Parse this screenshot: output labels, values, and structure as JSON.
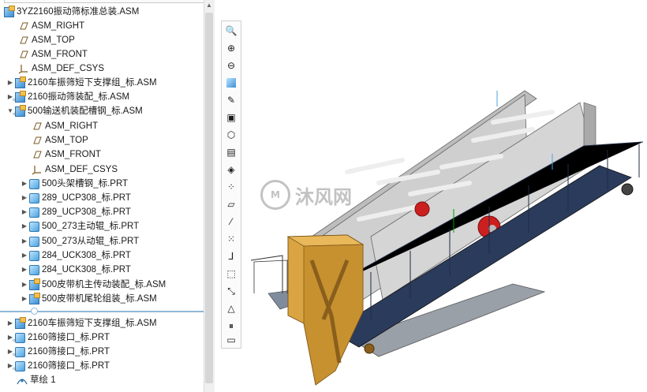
{
  "tree": {
    "items": [
      {
        "label": "3YZ2160振动筛标准总装.ASM",
        "icon": "assembly-icon"
      },
      {
        "label": "ASM_RIGHT",
        "icon": "datum-plane-icon"
      },
      {
        "label": "ASM_TOP",
        "icon": "datum-plane-icon"
      },
      {
        "label": "ASM_FRONT",
        "icon": "datum-plane-icon"
      },
      {
        "label": "ASM_DEF_CSYS",
        "icon": "csys-icon"
      },
      {
        "label": "2160车振筛短下支撑组_标.ASM",
        "icon": "assembly-icon"
      },
      {
        "label": "2160振动筛装配_标.ASM",
        "icon": "assembly-icon"
      },
      {
        "label": "500输送机装配槽钢_标.ASM",
        "icon": "assembly-icon"
      },
      {
        "label": "ASM_RIGHT",
        "icon": "datum-plane-icon"
      },
      {
        "label": "ASM_TOP",
        "icon": "datum-plane-icon"
      },
      {
        "label": "ASM_FRONT",
        "icon": "datum-plane-icon"
      },
      {
        "label": "ASM_DEF_CSYS",
        "icon": "csys-icon"
      },
      {
        "label": "500头架槽钢_标.PRT",
        "icon": "part-icon"
      },
      {
        "label": "289_UCP308_标.PRT",
        "icon": "part-icon"
      },
      {
        "label": "289_UCP308_标.PRT",
        "icon": "part-icon"
      },
      {
        "label": "500_273主动辊_标.PRT",
        "icon": "part-icon"
      },
      {
        "label": "500_273从动辊_标.PRT",
        "icon": "part-icon"
      },
      {
        "label": "284_UCK308_标.PRT",
        "icon": "part-icon"
      },
      {
        "label": "284_UCK308_标.PRT",
        "icon": "part-icon"
      },
      {
        "label": "500皮带机主传动装配_标.ASM",
        "icon": "assembly-icon"
      },
      {
        "label": "500皮带机尾轮组装_标.ASM",
        "icon": "assembly-icon"
      },
      {
        "label": "2160车振筛短下支撑组_标.ASM",
        "icon": "assembly-icon"
      },
      {
        "label": "2160筛接口_标.PRT",
        "icon": "part-icon"
      },
      {
        "label": "2160筛接口_标.PRT",
        "icon": "part-icon"
      },
      {
        "label": "2160筛接口_标.PRT",
        "icon": "part-icon"
      },
      {
        "label": "草绘 1",
        "icon": "sketch-icon"
      }
    ]
  },
  "toolbar": {
    "buttons": [
      "zoom-fit-icon",
      "zoom-in-icon",
      "zoom-out-icon",
      "repaint-icon",
      "spin-center-icon",
      "display-style-icon",
      "saved-views-icon",
      "view-manager-icon",
      "perspective-icon",
      "plane-display-icon",
      "axis-display-icon",
      "point-display-icon",
      "csys-display-icon",
      "annotation-display-icon",
      "spin-icon",
      "appearance-icon",
      "pause-icon",
      "eraser-icon"
    ]
  },
  "watermark": {
    "text": "沐风网"
  },
  "colors": {
    "accent": "#3a8fd4",
    "hopper": "#d9a441",
    "screen": "#c9c9c9",
    "belt": "#2b3b5c",
    "wheel": "#cc1f1f"
  }
}
